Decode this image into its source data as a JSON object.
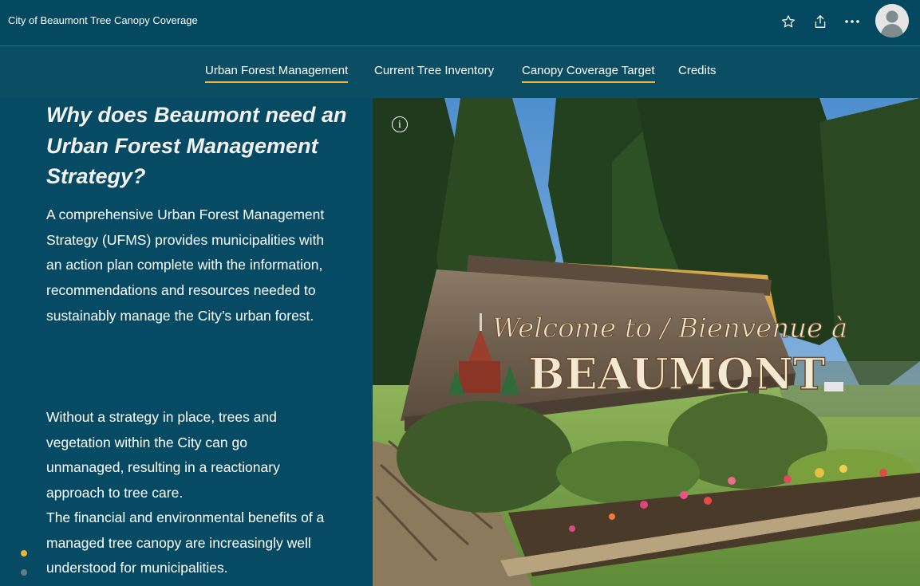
{
  "header": {
    "app_title": "City of Beaumont Tree Canopy Coverage",
    "icons": [
      "star-icon",
      "share-icon",
      "more-icon"
    ],
    "avatar_icon": "user-avatar-icon"
  },
  "nav": {
    "items": [
      {
        "label": "Urban Forest Management",
        "underlined": true
      },
      {
        "label": "Current Tree Inventory",
        "underlined": false
      },
      {
        "label": "Canopy Coverage Target",
        "underlined": true
      },
      {
        "label": "Credits",
        "underlined": false
      }
    ]
  },
  "content": {
    "heading": "Why does Beaumont need an Urban Forest Management Strategy?",
    "paragraph1": "A comprehensive Urban Forest Management Strategy (UFMS) provides municipalities with an action plan complete with the information, recommendations and resources needed to sustainably manage the City’s urban forest.",
    "paragraph2": "Without a strategy in place, trees and vegetation within the City can go unmanaged, resulting in a reactionary approach to tree care.",
    "paragraph3": "The financial and environmental benefits of a managed tree canopy are increasingly well understood for municipalities."
  },
  "photo": {
    "sign_line1": "Welcome to / Bienvenue à",
    "sign_line2": "BEAUMONT",
    "info_icon": "info-icon",
    "info_glyph": "i"
  },
  "pager": {
    "active_color": "#e8b73a",
    "inactive_color": "#5f7f8c"
  },
  "colors": {
    "background": "#064a63",
    "accent": "#e8b73a"
  }
}
